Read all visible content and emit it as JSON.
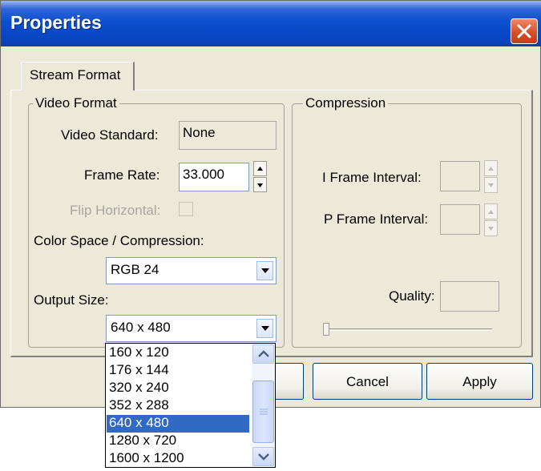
{
  "window": {
    "title": "Properties"
  },
  "tabs": [
    {
      "label": "Stream Format"
    }
  ],
  "video_format": {
    "group_label": "Video Format",
    "video_standard_label": "Video Standard:",
    "video_standard_value": "None",
    "frame_rate_label": "Frame Rate:",
    "frame_rate_value": "33.000",
    "flip_horizontal_label": "Flip Horizontal:",
    "color_space_label": "Color Space / Compression:",
    "color_space_value": "RGB 24",
    "output_size_label": "Output Size:",
    "output_size_value": "640 x 480"
  },
  "compression": {
    "group_label": "Compression",
    "i_frame_label": "I Frame Interval:",
    "p_frame_label": "P Frame Interval:",
    "quality_label": "Quality:"
  },
  "buttons": {
    "cancel": "Cancel",
    "apply": "Apply"
  },
  "output_size_options": [
    "160 x 120",
    "176 x 144",
    "320 x 240",
    "352 x 288",
    "640 x 480",
    "1280 x 720",
    "1600 x 1200"
  ],
  "selected_option_index": 4,
  "colors": {
    "titlebar": "#0a4fd0",
    "dialog_bg": "#ece9d8",
    "selection": "#316ac5",
    "close_button": "#d8502a"
  },
  "icons": [
    "close-icon",
    "spin-up-icon",
    "spin-down-icon",
    "dropdown-arrow-icon",
    "scroll-up-icon",
    "scroll-down-icon"
  ]
}
